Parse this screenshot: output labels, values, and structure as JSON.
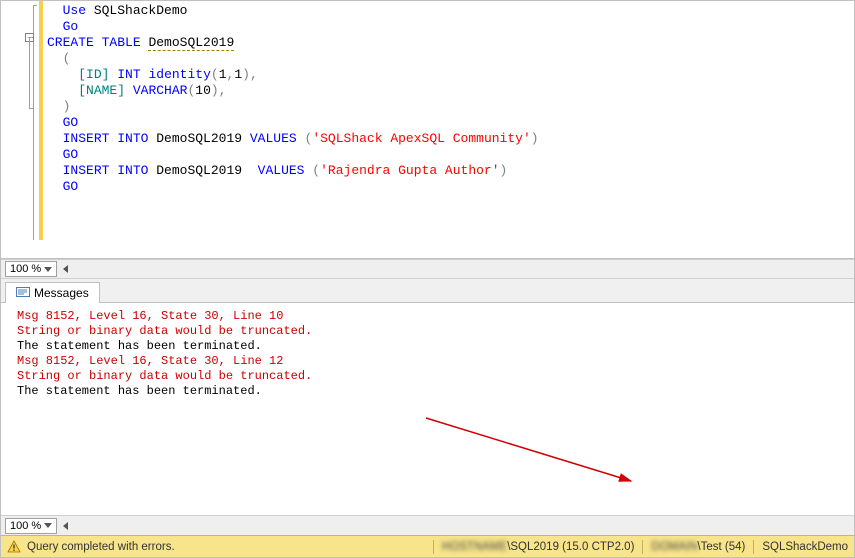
{
  "editor": {
    "code_lines": [
      {
        "segments": [
          {
            "t": "  ",
            "c": "plain"
          },
          {
            "t": "Use",
            "c": "kw"
          },
          {
            "t": " SQLShackDemo",
            "c": "plain"
          }
        ]
      },
      {
        "segments": [
          {
            "t": "  ",
            "c": "plain"
          },
          {
            "t": "Go",
            "c": "kw"
          }
        ]
      },
      {
        "segments": [
          {
            "t": "CREATE",
            "c": "kw"
          },
          {
            "t": " ",
            "c": "plain"
          },
          {
            "t": "TABLE",
            "c": "kw"
          },
          {
            "t": " ",
            "c": "plain"
          },
          {
            "t": "DemoSQL2019",
            "c": "plain name-underline"
          }
        ]
      },
      {
        "segments": [
          {
            "t": "  ",
            "c": "plain"
          },
          {
            "t": "(",
            "c": "op"
          }
        ]
      },
      {
        "segments": [
          {
            "t": "    ",
            "c": "plain"
          },
          {
            "t": "[ID]",
            "c": "ident"
          },
          {
            "t": " ",
            "c": "plain"
          },
          {
            "t": "INT",
            "c": "kw"
          },
          {
            "t": " ",
            "c": "plain"
          },
          {
            "t": "identity",
            "c": "kw"
          },
          {
            "t": "(",
            "c": "op"
          },
          {
            "t": "1",
            "c": "plain"
          },
          {
            "t": ",",
            "c": "op"
          },
          {
            "t": "1",
            "c": "plain"
          },
          {
            "t": "),",
            "c": "op"
          }
        ]
      },
      {
        "segments": [
          {
            "t": "    ",
            "c": "plain"
          },
          {
            "t": "[NAME]",
            "c": "ident"
          },
          {
            "t": " ",
            "c": "plain"
          },
          {
            "t": "VARCHAR",
            "c": "kw"
          },
          {
            "t": "(",
            "c": "op"
          },
          {
            "t": "10",
            "c": "plain"
          },
          {
            "t": "),",
            "c": "op"
          }
        ]
      },
      {
        "segments": [
          {
            "t": "  ",
            "c": "plain"
          },
          {
            "t": ")",
            "c": "op"
          }
        ]
      },
      {
        "segments": [
          {
            "t": "  ",
            "c": "plain"
          },
          {
            "t": "GO",
            "c": "kw"
          }
        ]
      },
      {
        "segments": [
          {
            "t": "  ",
            "c": "plain"
          },
          {
            "t": "INSERT",
            "c": "kw"
          },
          {
            "t": " ",
            "c": "plain"
          },
          {
            "t": "INTO",
            "c": "kw"
          },
          {
            "t": " DemoSQL2019 ",
            "c": "plain"
          },
          {
            "t": "VALUES",
            "c": "kw"
          },
          {
            "t": " ",
            "c": "plain"
          },
          {
            "t": "(",
            "c": "op"
          },
          {
            "t": "'SQLShack ApexSQL Community'",
            "c": "str"
          },
          {
            "t": ")",
            "c": "op"
          }
        ]
      },
      {
        "segments": [
          {
            "t": "  ",
            "c": "plain"
          },
          {
            "t": "GO",
            "c": "kw"
          }
        ]
      },
      {
        "segments": [
          {
            "t": "  ",
            "c": "plain"
          },
          {
            "t": "INSERT",
            "c": "kw"
          },
          {
            "t": " ",
            "c": "plain"
          },
          {
            "t": "INTO",
            "c": "kw"
          },
          {
            "t": " DemoSQL2019  ",
            "c": "plain"
          },
          {
            "t": "VALUES",
            "c": "kw"
          },
          {
            "t": " ",
            "c": "plain"
          },
          {
            "t": "(",
            "c": "op"
          },
          {
            "t": "'Rajendra Gupta Author'",
            "c": "str"
          },
          {
            "t": ")",
            "c": "op"
          }
        ]
      },
      {
        "segments": [
          {
            "t": "  ",
            "c": "plain"
          },
          {
            "t": "GO",
            "c": "kw"
          }
        ]
      }
    ]
  },
  "zoom": {
    "value": "100 %"
  },
  "tabs": {
    "messages": "Messages"
  },
  "messages": {
    "lines": [
      {
        "t": "Msg 8152, Level 16, State 30, Line 10",
        "c": "msg-err"
      },
      {
        "t": "String or binary data would be truncated.",
        "c": "msg-err"
      },
      {
        "t": "The statement has been terminated.",
        "c": "msg-plain"
      },
      {
        "t": "Msg 8152, Level 16, State 30, Line 12",
        "c": "msg-err"
      },
      {
        "t": "String or binary data would be truncated.",
        "c": "msg-err"
      },
      {
        "t": "The statement has been terminated.",
        "c": "msg-plain"
      }
    ]
  },
  "status": {
    "text": "Query completed with errors.",
    "server": "\\SQL2019 (15.0 CTP2.0)",
    "user": "\\Test (54)",
    "db": "SQLShackDemo"
  }
}
